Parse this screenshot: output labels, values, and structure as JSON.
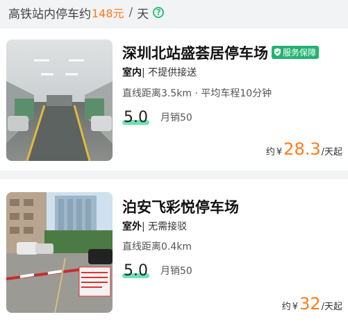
{
  "header": {
    "prefix": "高铁站内停车约",
    "price": "148元",
    "separator": "/",
    "unit": "天"
  },
  "listings": [
    {
      "title": "深圳北站盛荟居停车场",
      "badge": "服务保障",
      "location_type": "室内",
      "service": "| 不提供接送",
      "distance": "直线距离3.5km · 平均车程10分钟",
      "score": "5.0",
      "sales": "月销50",
      "price_prefix": "约",
      "currency": "¥",
      "price": "28.3",
      "price_unit": "/天起"
    },
    {
      "title": "泊安飞彩悦停车场",
      "location_type": "室外",
      "service": "| 无需接驳",
      "distance": "直线距离0.4km",
      "score": "5.0",
      "sales": "月销50",
      "price_prefix": "约",
      "currency": "¥",
      "price": "32",
      "price_unit": "/天起"
    }
  ],
  "colors": {
    "accent": "#ff7a1a",
    "badge": "#23b36f",
    "score_highlight": "#6ee0b6"
  }
}
